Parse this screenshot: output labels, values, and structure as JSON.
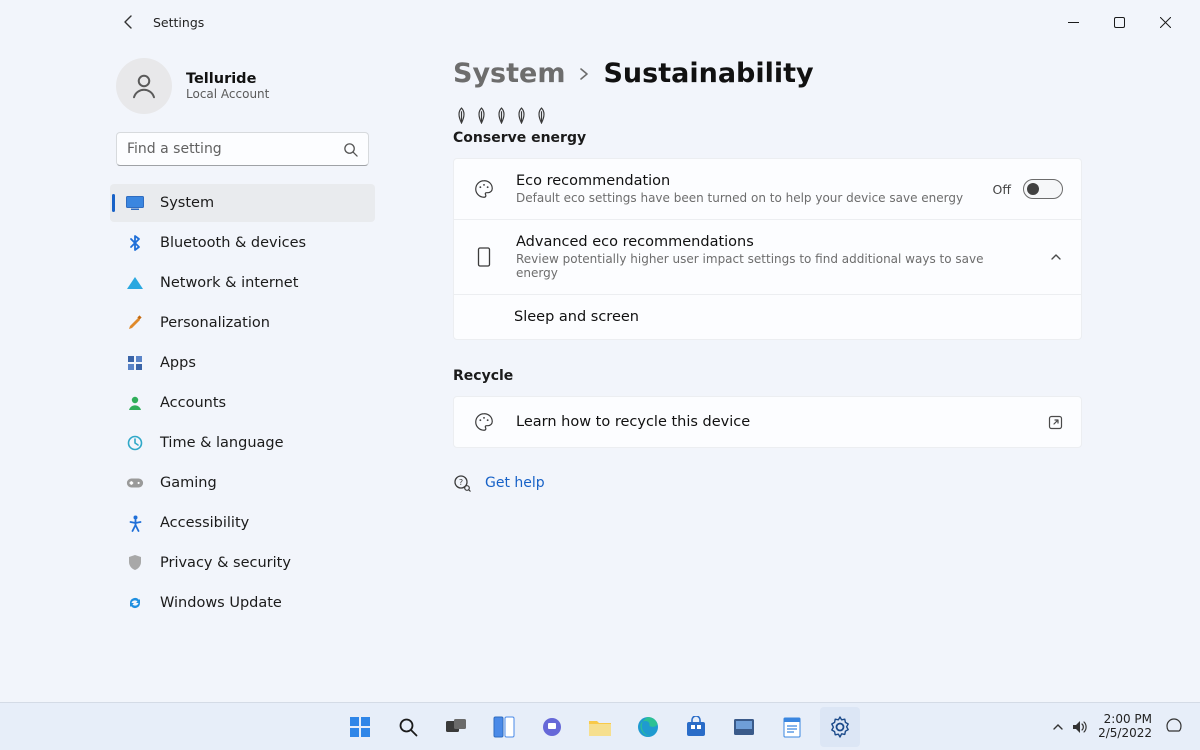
{
  "window": {
    "app_title": "Settings"
  },
  "profile": {
    "name": "Telluride",
    "subtitle": "Local Account"
  },
  "search": {
    "placeholder": "Find a setting"
  },
  "nav": {
    "items": [
      {
        "label": "System",
        "icon": "display-icon",
        "color": "#2f7fe0",
        "active": true
      },
      {
        "label": "Bluetooth & devices",
        "icon": "bluetooth-icon",
        "color": "#1f6fd8"
      },
      {
        "label": "Network & internet",
        "icon": "wifi-icon",
        "color": "#2aa8e0"
      },
      {
        "label": "Personalization",
        "icon": "brush-icon",
        "color": "#e08a2a"
      },
      {
        "label": "Apps",
        "icon": "apps-icon",
        "color": "#3a64a8"
      },
      {
        "label": "Accounts",
        "icon": "person-icon",
        "color": "#2fae5a"
      },
      {
        "label": "Time & language",
        "icon": "globe-clock-icon",
        "color": "#2fa8c8"
      },
      {
        "label": "Gaming",
        "icon": "gamepad-icon",
        "color": "#8f8f8f"
      },
      {
        "label": "Accessibility",
        "icon": "accessibility-icon",
        "color": "#1f6fd8"
      },
      {
        "label": "Privacy & security",
        "icon": "shield-icon",
        "color": "#8a8a8a"
      },
      {
        "label": "Windows Update",
        "icon": "update-icon",
        "color": "#1f8fe0"
      }
    ]
  },
  "breadcrumb": {
    "parent": "System",
    "current": "Sustainability"
  },
  "conserve": {
    "label": "Conserve energy",
    "eco": {
      "title": "Eco recommendation",
      "sub": "Default eco settings have been turned on to help your device save energy",
      "toggle_label": "Off",
      "toggle_on": false
    },
    "advanced": {
      "title": "Advanced eco recommendations",
      "sub": "Review potentially higher user impact settings to find additional ways to save energy"
    },
    "sleep": {
      "title": "Sleep and screen"
    }
  },
  "recycle": {
    "label": "Recycle",
    "learn": "Learn how to recycle this device"
  },
  "help": {
    "label": "Get help"
  },
  "taskbar": {
    "time": "2:00 PM",
    "date": "2/5/2022"
  }
}
